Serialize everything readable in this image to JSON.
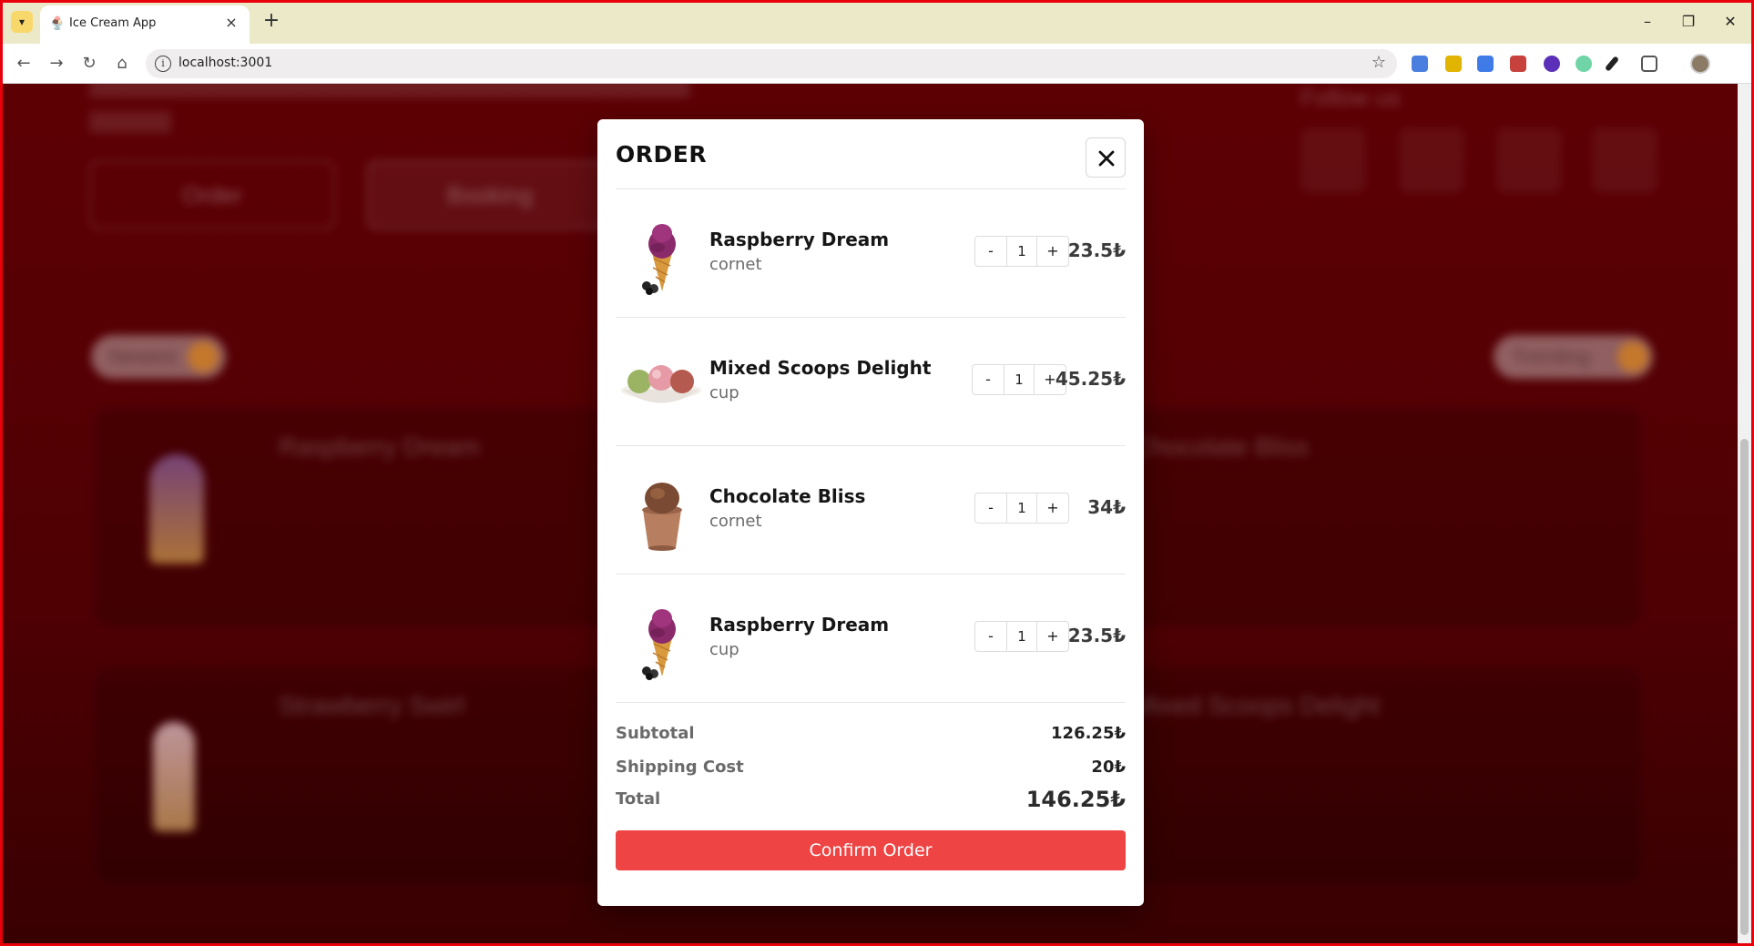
{
  "browser": {
    "tab_title": "Ice Cream App",
    "url": "localhost:3001"
  },
  "background": {
    "order_button": "Order",
    "booking_button": "Booking",
    "follow_text": "Follow us",
    "tab_left": "Newest",
    "tab_right": "Trending",
    "card_titles": [
      "Raspberry Dream",
      "Chocolate Bliss",
      "Strawberry Swirl",
      "Mixed Scoops Delight"
    ]
  },
  "modal": {
    "title": "ORDER",
    "items": [
      {
        "name": "Raspberry Dream",
        "type": "cornet",
        "quantity": "1",
        "price": "23.5₺",
        "image": "raspberry-cone"
      },
      {
        "name": "Mixed Scoops Delight",
        "type": "cup",
        "quantity": "1",
        "price": "45.25₺",
        "image": "mixed-scoops-bowl"
      },
      {
        "name": "Chocolate Bliss",
        "type": "cornet",
        "quantity": "1",
        "price": "34₺",
        "image": "chocolate-cup"
      },
      {
        "name": "Raspberry Dream",
        "type": "cup",
        "quantity": "1",
        "price": "23.5₺",
        "image": "raspberry-cone"
      }
    ],
    "stepper_minus": "-",
    "stepper_plus": "+",
    "subtotal_label": "Subtotal",
    "subtotal_value": "126.25₺",
    "shipping_label": "Shipping Cost",
    "shipping_value": "20₺",
    "total_label": "Total",
    "total_value": "146.25₺",
    "confirm_label": "Confirm Order"
  },
  "colors": {
    "accent": "#ef4444",
    "page_background": "#5a0004",
    "tabbar": "#ece9c9"
  }
}
